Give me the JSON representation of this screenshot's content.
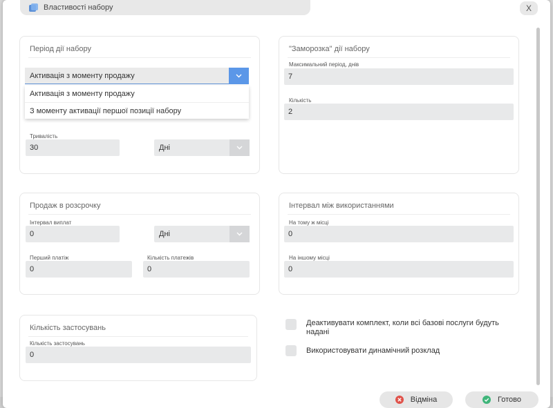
{
  "dialog": {
    "title": "Властивості набору",
    "close_label": "X",
    "title_icon": "stack-icon"
  },
  "period": {
    "title": "Період дії набору",
    "activation_select": {
      "value": "Активація з моменту продажу",
      "options": [
        "Активація з моменту продажу",
        "З моменту активації першої позиції набору"
      ]
    },
    "duration_label": "Тривалість",
    "duration_value": "30",
    "duration_unit": "Дні"
  },
  "freeze": {
    "title": "\"Заморозка\" дії набору",
    "max_period_label": "Максимальний період, днів",
    "max_period_value": "7",
    "count_label": "Кількість",
    "count_value": "2"
  },
  "installment": {
    "title": "Продаж в розсрочку",
    "interval_label": "Інтервал виплат",
    "interval_value": "0",
    "interval_unit": "Дні",
    "first_payment_label": "Перший платіж",
    "first_payment_value": "0",
    "payments_count_label": "Кількість платежів",
    "payments_count_value": "0"
  },
  "usage_interval": {
    "title": "Інтервал між використаннями",
    "same_place_label": "На тому ж місці",
    "same_place_value": "0",
    "other_place_label": "На іншому місці",
    "other_place_value": "0"
  },
  "applications": {
    "title": "Кількість застосувань",
    "count_label": "Кількість застосувань",
    "count_value": "0"
  },
  "options": {
    "deactivate_label": "Деактивувати комплект, коли всі базові послуги будуть надані",
    "dynamic_schedule_label": "Використовувати динамічний розклад"
  },
  "footer": {
    "cancel_label": "Відміна",
    "done_label": "Готово"
  },
  "colors": {
    "accent": "#5b97e8",
    "cancel_icon": "#e0524a",
    "done_icon": "#3fb57a"
  }
}
